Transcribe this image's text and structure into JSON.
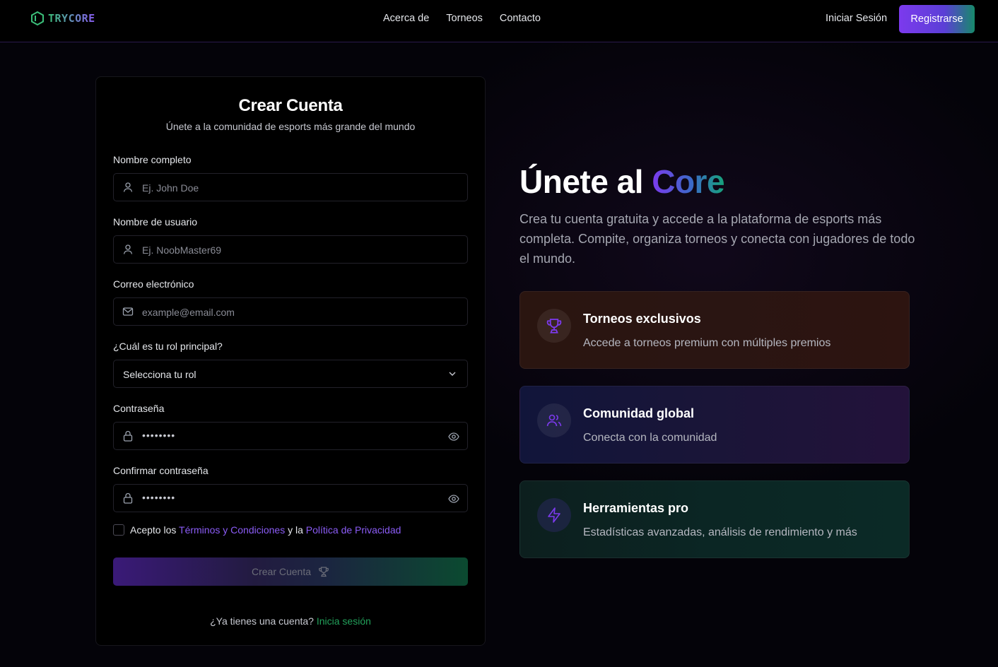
{
  "nav": {
    "logo_text": "TRYCORE",
    "links": [
      "Acerca de",
      "Torneos",
      "Contacto"
    ],
    "login": "Iniciar Sesión",
    "register": "Registrarse"
  },
  "form": {
    "title": "Crear Cuenta",
    "subtitle": "Únete a la comunidad de esports más grande del mundo",
    "full_name": {
      "label": "Nombre completo",
      "placeholder": "Ej. John Doe"
    },
    "username": {
      "label": "Nombre de usuario",
      "placeholder": "Ej. NoobMaster69"
    },
    "email": {
      "label": "Correo electrónico",
      "placeholder": "example@email.com"
    },
    "role": {
      "label": "¿Cuál es tu rol principal?",
      "selected": "Selecciona tu rol"
    },
    "password": {
      "label": "Contraseña",
      "value": "••••••••"
    },
    "confirm": {
      "label": "Confirmar contraseña",
      "value": "••••••••"
    },
    "terms": {
      "prefix": "Acepto los",
      "terms_link": "Términos y Condiciones",
      "middle": "y la",
      "privacy_link": "Política de Privacidad"
    },
    "submit": "Crear Cuenta",
    "have_account": "¿Ya tienes una cuenta?",
    "login_link": "Inicia sesión"
  },
  "hero": {
    "title_prefix": "Únete al",
    "title_accent": "Core",
    "description": "Crea tu cuenta gratuita y accede a la plataforma de esports más completa. Compite, organiza torneos y conecta con jugadores de todo el mundo."
  },
  "features": [
    {
      "title": "Torneos exclusivos",
      "desc": "Accede a torneos premium con múltiples premios",
      "icon": "trophy-icon"
    },
    {
      "title": "Comunidad global",
      "desc": "Conecta con la comunidad",
      "icon": "users-icon"
    },
    {
      "title": "Herramientas pro",
      "desc": "Estadísticas avanzadas, análisis de rendimiento y más",
      "icon": "lightning-icon"
    }
  ],
  "colors": {
    "accent_purple": "#7c3aed",
    "link_purple": "#8b5cf6",
    "link_green": "#22a05a"
  }
}
